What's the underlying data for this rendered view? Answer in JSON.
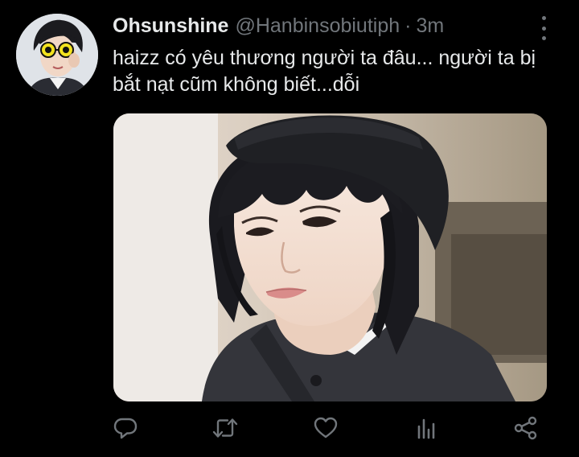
{
  "tweet": {
    "author": {
      "display_name": "Ohsunshine",
      "handle": "@Hanbinsobiutiph",
      "separator": "·",
      "time": "3m"
    },
    "text": "haizz có yêu thương người ta đâu... người ta bị bắt nạt cũm không biết...dỗi",
    "media": {
      "type": "photo"
    },
    "actions": [
      "reply-icon",
      "retweet-icon",
      "like-icon",
      "analytics-icon",
      "share-icon"
    ]
  },
  "colors": {
    "background": "#000000",
    "text": "#e7e9ea",
    "muted": "#71767b"
  }
}
